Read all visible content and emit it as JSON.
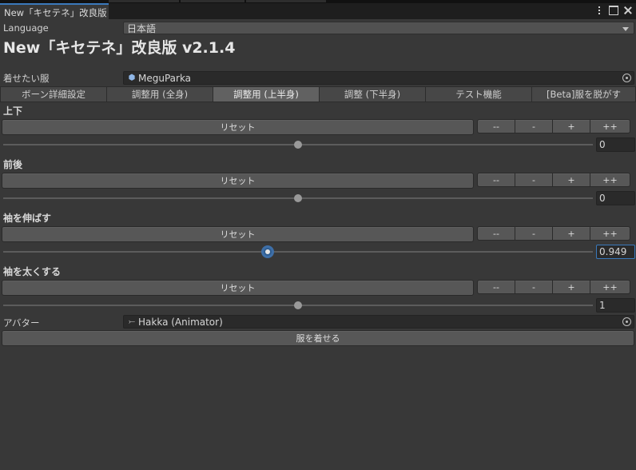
{
  "window": {
    "tab_title": "New「キセテネ」改良版"
  },
  "language": {
    "label": "Language",
    "value": "日本語"
  },
  "title": "New「キセテネ」改良版 v2.1.4",
  "outfit": {
    "label": "着せたい服",
    "value": "MeguParka"
  },
  "tabs": [
    "ボーン詳細設定",
    "調整用 (全身)",
    "調整用 (上半身)",
    "調整 (下半身)",
    "テスト機能",
    "[Beta]服を脱がす"
  ],
  "active_tab_index": 2,
  "steps": [
    "--",
    "-",
    "+",
    "++"
  ],
  "sections": [
    {
      "label": "上下",
      "reset": "リセット",
      "value": "0",
      "slider": 0.5
    },
    {
      "label": "前後",
      "reset": "リセット",
      "value": "0",
      "slider": 0.5
    },
    {
      "label": "袖を伸ばす",
      "reset": "リセット",
      "value": "0.949",
      "slider": 0.4491
    },
    {
      "label": "袖を太くする",
      "reset": "リセット",
      "value": "1",
      "slider": 0.5
    }
  ],
  "avatar": {
    "label": "アバター",
    "value": "Hakka (Animator)"
  },
  "apply_button": "服を着せる",
  "icons": {
    "outfit": "prefab-cube-icon",
    "avatar": "animator-icon",
    "picker": "object-picker-icon",
    "menu": "kebab-menu-icon",
    "maximize": "maximize-icon",
    "close": "close-icon"
  },
  "colors": {
    "focus": "#3a79bb"
  }
}
